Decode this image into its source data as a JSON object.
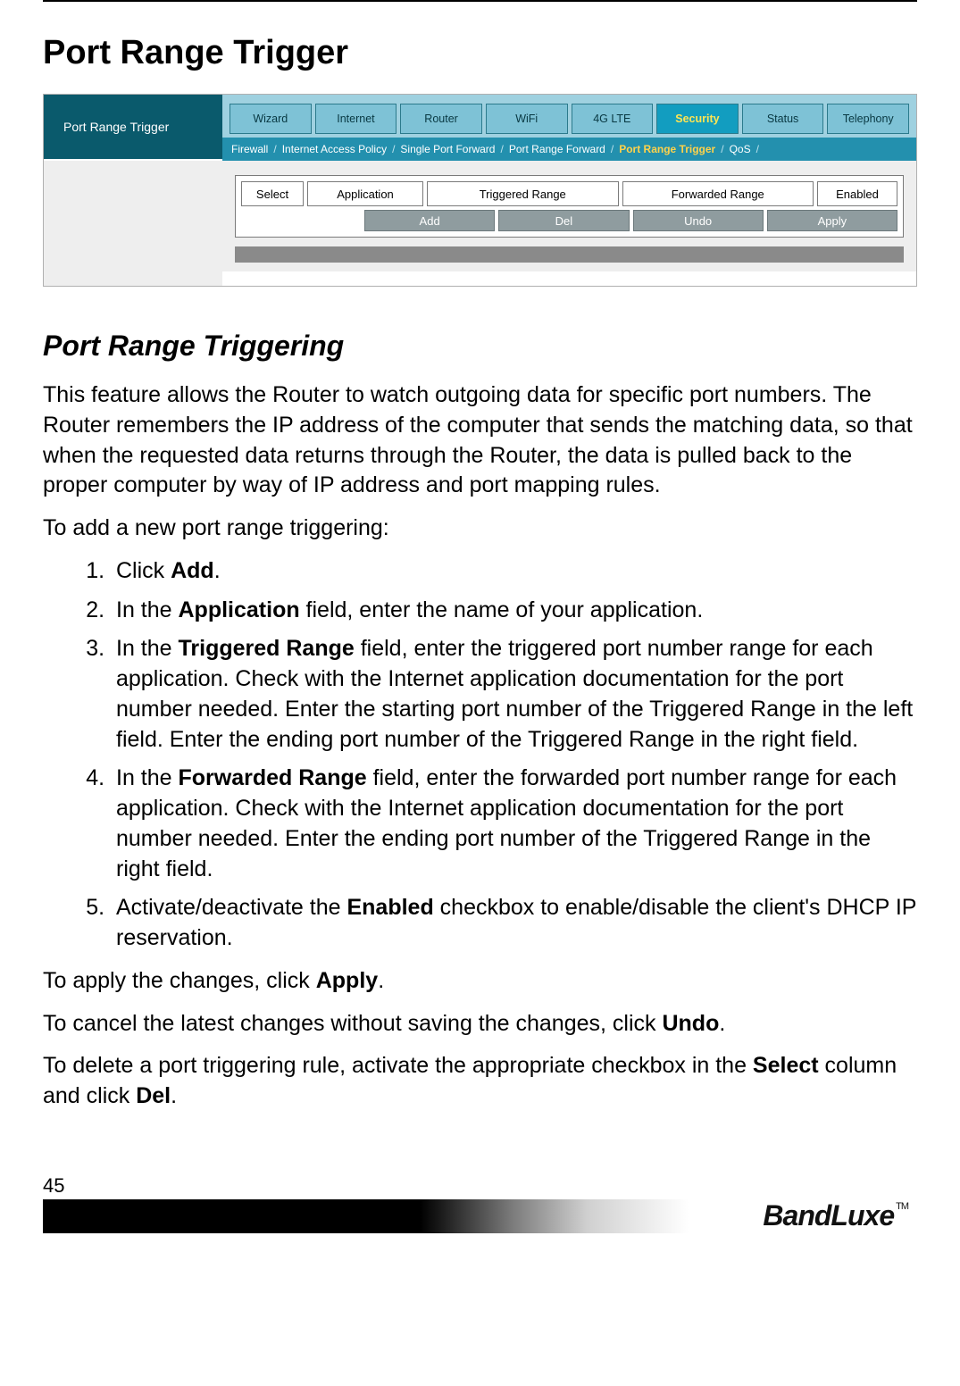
{
  "page_number": "45",
  "brand": "BandLuxe",
  "brand_tm": "TM",
  "headings": {
    "h1": "Port Range Trigger",
    "h2": "Port Range Triggering"
  },
  "screenshot": {
    "sidebar_title": "Port Range Trigger",
    "tabs": [
      "Wizard",
      "Internet",
      "Router",
      "WiFi",
      "4G LTE",
      "Security",
      "Status",
      "Telephony"
    ],
    "active_tab_index": 5,
    "subnav": [
      "Firewall",
      "Internet Access Policy",
      "Single Port Forward",
      "Port Range Forward",
      "Port Range Trigger",
      "QoS"
    ],
    "subnav_active_index": 4,
    "columns": [
      "Select",
      "Application",
      "Triggered Range",
      "Forwarded Range",
      "Enabled"
    ],
    "buttons": [
      "Add",
      "Del",
      "Undo",
      "Apply"
    ]
  },
  "paragraphs": {
    "intro": "This feature allows the Router to watch outgoing data for specific port numbers. The Router remembers the IP address of the computer that sends the matching data, so that when the requested data returns through the Router, the data is pulled back to the proper computer by way of IP address and port mapping rules.",
    "to_add": "To add a new port range triggering:",
    "apply": [
      "To apply the changes, click ",
      "Apply",
      "."
    ],
    "undo": [
      "To cancel the latest changes without saving the changes, click ",
      "Undo",
      "."
    ],
    "del": [
      "To delete a port triggering rule, activate the appropriate checkbox in the ",
      "Select",
      " column and click ",
      "Del",
      "."
    ]
  },
  "steps": {
    "1": [
      "Click ",
      "Add",
      "."
    ],
    "2": [
      "In the ",
      "Application",
      " field, enter the name of your application."
    ],
    "3": [
      "In the ",
      "Triggered Range",
      " field, enter the triggered port number range for each application. Check with the Internet application documentation for the port number needed. Enter the starting port number of the Triggered Range in the left field. Enter the ending port number of the Triggered Range in the right field."
    ],
    "4": [
      "In the ",
      "Forwarded Range",
      " field, enter the forwarded port number range for each application. Check with the Internet application documentation for the port number needed. Enter the ending port number of the Triggered Range in the right field."
    ],
    "5": [
      "Activate/deactivate the ",
      "Enabled",
      " checkbox to enable/disable the client's DHCP IP reservation."
    ]
  }
}
